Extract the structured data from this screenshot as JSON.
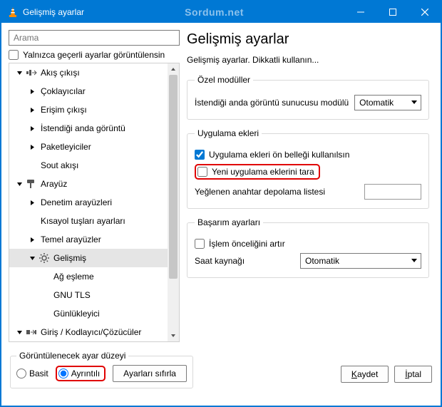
{
  "window": {
    "title": "Gelişmiş ayarlar",
    "watermark": "Sordum.net"
  },
  "search": {
    "placeholder": "Arama"
  },
  "only_current_label": "Yalnızca geçerli ayarlar görüntülensin",
  "tree": {
    "items": [
      {
        "label": "Akış çıkışı",
        "depth": 0,
        "expanded": true,
        "kind": "stream"
      },
      {
        "label": "Çoklayıcılar",
        "depth": 1,
        "expanded": false
      },
      {
        "label": "Erişim çıkışı",
        "depth": 1,
        "expanded": false
      },
      {
        "label": "İstendiği anda görüntü",
        "depth": 1,
        "expanded": false
      },
      {
        "label": "Paketleyiciler",
        "depth": 1,
        "expanded": false
      },
      {
        "label": "Sout akışı",
        "depth": 1
      },
      {
        "label": "Arayüz",
        "depth": 0,
        "expanded": true,
        "kind": "brush"
      },
      {
        "label": "Denetim arayüzleri",
        "depth": 1,
        "expanded": false
      },
      {
        "label": "Kısayol tuşları ayarları",
        "depth": 1
      },
      {
        "label": "Temel arayüzler",
        "depth": 1,
        "expanded": false
      },
      {
        "label": "Gelişmiş",
        "depth": 1,
        "expanded": true,
        "kind": "gear",
        "selected": true
      },
      {
        "label": "Ağ eşleme",
        "depth": 2
      },
      {
        "label": "GNU TLS",
        "depth": 2
      },
      {
        "label": "Günlükleyici",
        "depth": 2
      },
      {
        "label": "Giriş / Kodlayıcı/Çözücüler",
        "depth": 0,
        "expanded": true,
        "kind": "io"
      }
    ]
  },
  "page": {
    "title": "Gelişmiş ayarlar",
    "subtitle": "Gelişmiş ayarlar. Dikkatli kullanın..."
  },
  "group_modules": {
    "legend": "Özel modüller",
    "row_label": "İstendiği anda görüntü sunucusu modülü",
    "combo_value": "Otomatik"
  },
  "group_plugins": {
    "legend": "Uygulama ekleri",
    "chk_cache": "Uygulama ekleri ön belleği kullanılsın",
    "chk_scan": "Yeni uygulama eklerini tara",
    "key_store_label": "Yeğlenen anahtar depolama listesi"
  },
  "group_perf": {
    "legend": "Başarım ayarları",
    "chk_priority": "İşlem önceliğini artır",
    "clock_label": "Saat kaynağı",
    "clock_value": "Otomatik"
  },
  "bottom": {
    "group_legend": "Görüntülenecek ayar düzeyi",
    "radio_basic": "Basit",
    "radio_advanced": "Ayrıntılı",
    "reset": "Ayarları sıfırla",
    "save": "Kaydet",
    "cancel": "İptal"
  }
}
